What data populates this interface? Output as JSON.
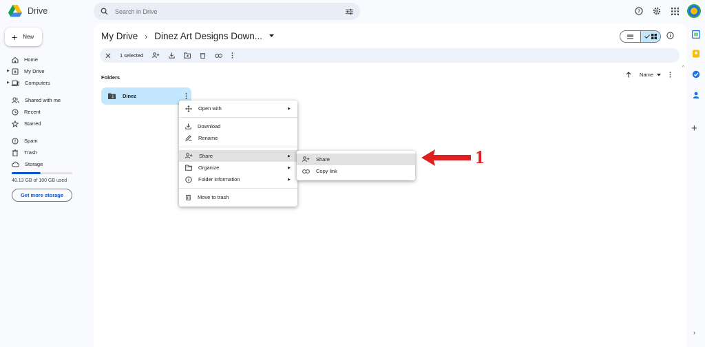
{
  "header": {
    "app_name": "Drive",
    "search_placeholder": "Search in Drive",
    "icons": [
      "drive-logo-icon",
      "search-icon",
      "filter-options-icon",
      "help-icon",
      "settings-icon",
      "apps-grid-icon",
      "avatar"
    ]
  },
  "sidebar": {
    "new_label": "New",
    "items": [
      {
        "label": "Home",
        "icon": "home-icon"
      },
      {
        "label": "My Drive",
        "icon": "my-drive-icon"
      },
      {
        "label": "Computers",
        "icon": "computers-icon"
      },
      {
        "label": "Shared with me",
        "icon": "shared-icon"
      },
      {
        "label": "Recent",
        "icon": "clock-icon"
      },
      {
        "label": "Starred",
        "icon": "star-icon"
      },
      {
        "label": "Spam",
        "icon": "spam-icon"
      },
      {
        "label": "Trash",
        "icon": "trash-icon"
      },
      {
        "label": "Storage",
        "icon": "cloud-icon"
      }
    ],
    "storage_text": "48.13 GB of 100 GB used",
    "storage_fraction": 0.48,
    "get_storage_label": "Get more storage"
  },
  "main": {
    "breadcrumb_root": "My Drive",
    "breadcrumb_current": "Dinez Art Designs Down...",
    "selection_text": "1 selected",
    "folders_label": "Folders",
    "sort_label": "Name",
    "folder_name": "Dinez"
  },
  "context_menu": {
    "items": [
      {
        "label": "Open with",
        "icon": "open-with-icon",
        "submenu": true
      },
      {
        "label": "Download",
        "icon": "download-icon"
      },
      {
        "label": "Rename",
        "icon": "rename-icon"
      },
      {
        "label": "Share",
        "icon": "share-person-icon",
        "submenu": true,
        "highlighted": true
      },
      {
        "label": "Organize",
        "icon": "organize-folder-icon",
        "submenu": true
      },
      {
        "label": "Folder information",
        "icon": "info-icon",
        "submenu": true
      },
      {
        "label": "Move to trash",
        "icon": "trash-icon"
      }
    ]
  },
  "share_submenu": {
    "items": [
      {
        "label": "Share",
        "icon": "share-person-icon",
        "highlighted": true
      },
      {
        "label": "Copy link",
        "icon": "link-icon"
      }
    ]
  },
  "annotation": {
    "number": "1",
    "color": "#e02020"
  },
  "colors": {
    "accent": "#0b57d0",
    "selected": "#c2e7ff",
    "background": "#f8fafd"
  }
}
